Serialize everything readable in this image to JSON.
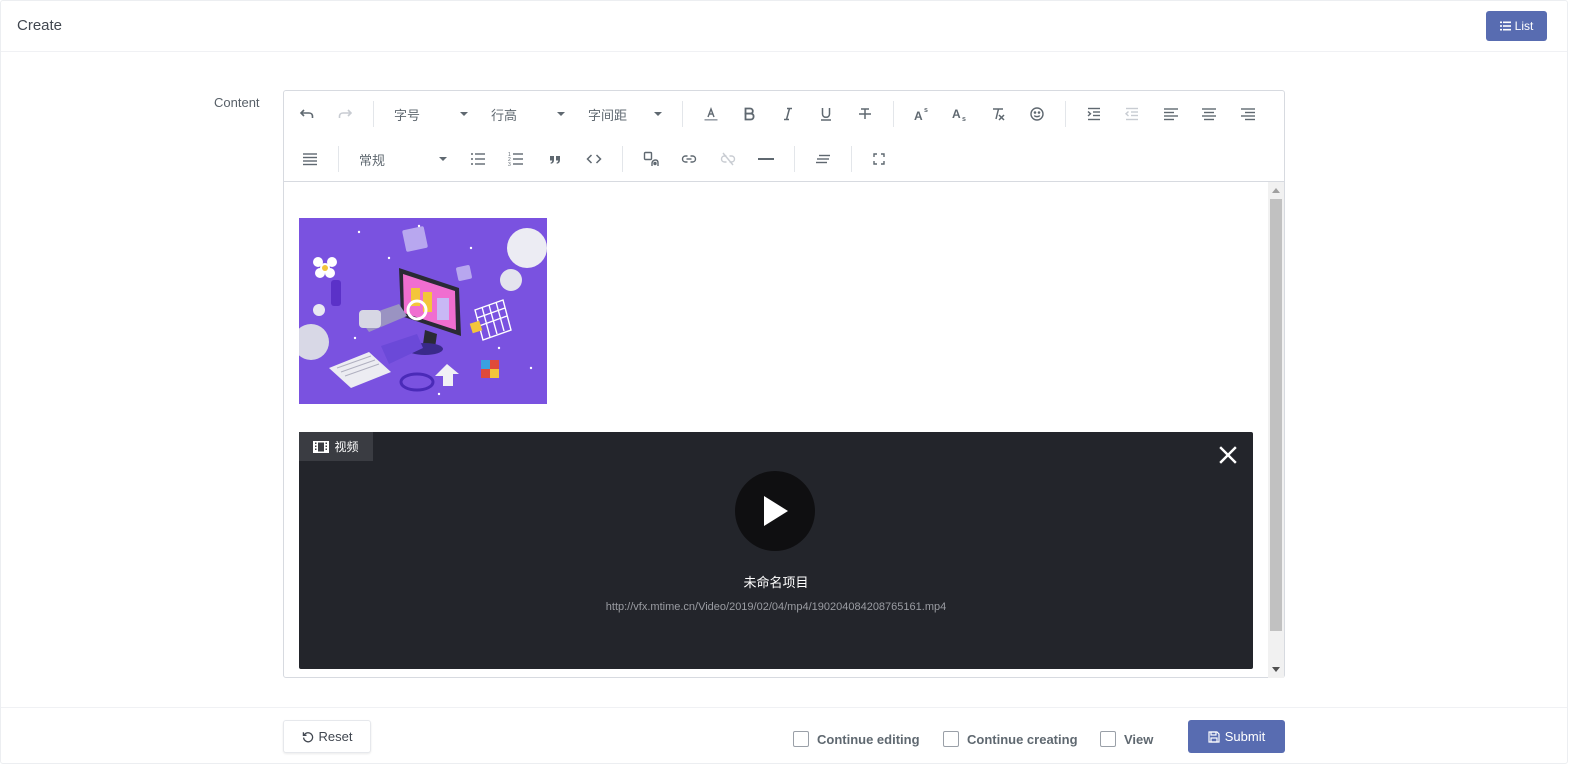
{
  "header": {
    "title": "Create",
    "list_button": "List"
  },
  "form": {
    "content_label": "Content"
  },
  "toolbar": {
    "font_size": "字号",
    "line_height": "行高",
    "letter_spacing": "字间距",
    "heading": "常规",
    "icons": [
      "undo-icon",
      "redo-icon",
      "font-color-icon",
      "bold-icon",
      "italic-icon",
      "underline-icon",
      "strikethrough-icon",
      "superscript-icon",
      "subscript-icon",
      "clear-format-icon",
      "emoji-icon",
      "indent-icon",
      "outdent-icon",
      "align-left-icon",
      "align-center-icon",
      "align-right-icon",
      "justify-icon",
      "bullet-list-icon",
      "numbered-list-icon",
      "quote-icon",
      "code-icon",
      "media-icon",
      "link-icon",
      "unlink-icon",
      "horizontal-rule-icon",
      "text-direction-icon",
      "fullscreen-icon"
    ]
  },
  "editor": {
    "video": {
      "tag": "视频",
      "name": "未命名项目",
      "url": "http://vfx.mtime.cn/Video/2019/02/04/mp4/190204084208765161.mp4"
    }
  },
  "footer": {
    "reset": "Reset",
    "continue_editing": "Continue editing",
    "continue_creating": "Continue creating",
    "view": "View",
    "submit": "Submit"
  },
  "colors": {
    "primary": "#586cb1",
    "video_bg": "#23252b",
    "image_bg": "#7a52e0"
  }
}
